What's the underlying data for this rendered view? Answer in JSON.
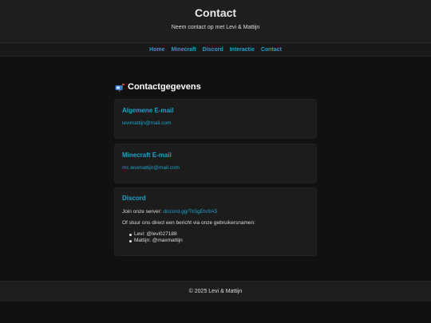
{
  "header": {
    "title": "Contact",
    "subtitle": "Neem contact op met Levi & Mattijn"
  },
  "nav": {
    "items": [
      "Home",
      "Minecraft",
      "Discord",
      "Interactie",
      "Contact"
    ]
  },
  "section": {
    "icon": "mailbox-icon",
    "title": "Contactgegevens"
  },
  "cards": {
    "email": {
      "title": "Algemene E-mail",
      "address": "levimattijn@mail.com"
    },
    "minecraft": {
      "title": "Minecraft E-mail",
      "address": "mc.levimattijn@mail.com"
    },
    "discord": {
      "title": "Discord",
      "join_text": "Join onze server:",
      "invite_link": "discord.gg/Tk5gEtvSA5",
      "dm_text": "Of stuur ons direct een bericht via onze gebruikersnamen:",
      "users": [
        "Levi: @levi027188",
        "Mattijn: @maxmattijn"
      ]
    }
  },
  "footer": {
    "text": "© 2025 Levi & Mattijn"
  },
  "colors": {
    "accent": "#1aa3cc",
    "background": "#111111",
    "card": "#1c1c1c"
  }
}
